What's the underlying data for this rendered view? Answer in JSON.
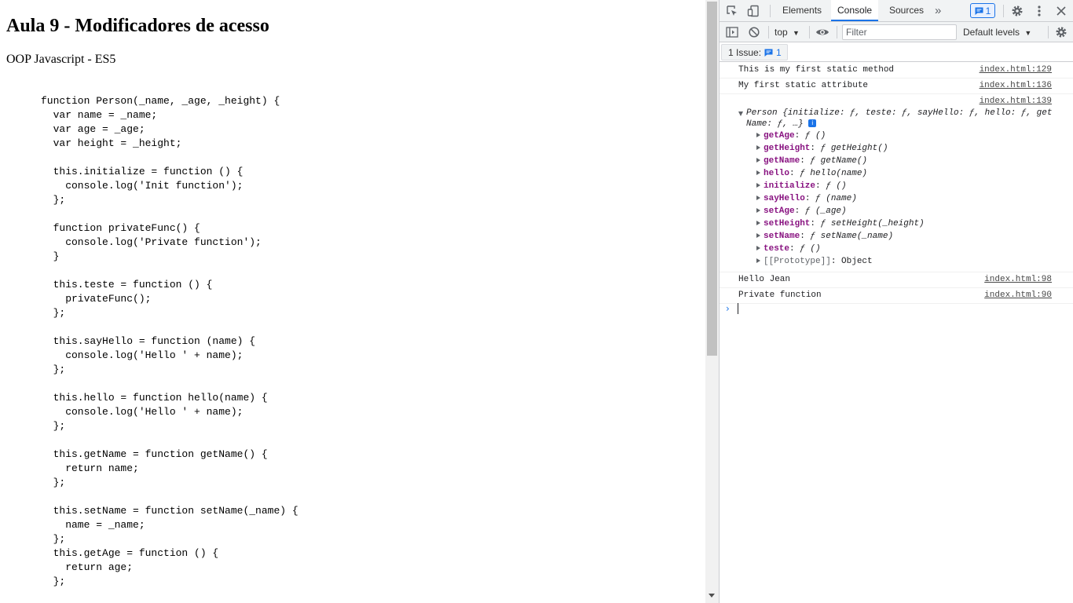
{
  "page": {
    "title": "Aula 9 - Modificadores de acesso",
    "subtitle": "OOP Javascript - ES5",
    "code_lines": [
      "function Person(_name, _age, _height) {",
      "  var name = _name;",
      "  var age = _age;",
      "  var height = _height;",
      "",
      "  this.initialize = function () {",
      "    console.log('Init function');",
      "  };",
      "",
      "  function privateFunc() {",
      "    console.log('Private function');",
      "  }",
      "",
      "  this.teste = function () {",
      "    privateFunc();",
      "  };",
      "",
      "  this.sayHello = function (name) {",
      "    console.log('Hello ' + name);",
      "  };",
      "",
      "  this.hello = function hello(name) {",
      "    console.log('Hello ' + name);",
      "  };",
      "",
      "  this.getName = function getName() {",
      "    return name;",
      "  };",
      "",
      "  this.setName = function setName(_name) {",
      "    name = _name;",
      "  };",
      "  this.getAge = function () {",
      "    return age;",
      "  };"
    ]
  },
  "devtools": {
    "tabs": [
      "Elements",
      "Console",
      "Sources"
    ],
    "active_tab": "Console",
    "more_tabs_glyph": "»",
    "issues_badge_count": "1",
    "toolbar": {
      "context": "top",
      "filter_placeholder": "Filter",
      "levels": "Default levels"
    },
    "issues_bar": {
      "label": "1 Issue:",
      "count": "1"
    },
    "messages": [
      {
        "text": "This is my first static method",
        "source": "index.html:129"
      },
      {
        "text": "My first static attribute",
        "source": "index.html:136"
      }
    ],
    "object_message": {
      "source": "index.html:139",
      "summary": "Person {initialize: ƒ, teste: ƒ, sayHello: ƒ, hello: ƒ, getName: ƒ, …}",
      "info_glyph": "i",
      "properties": [
        {
          "key": "getAge",
          "value": "ƒ ()"
        },
        {
          "key": "getHeight",
          "value": "ƒ getHeight()"
        },
        {
          "key": "getName",
          "value": "ƒ getName()"
        },
        {
          "key": "hello",
          "value": "ƒ hello(name)"
        },
        {
          "key": "initialize",
          "value": "ƒ ()"
        },
        {
          "key": "sayHello",
          "value": "ƒ (name)"
        },
        {
          "key": "setAge",
          "value": "ƒ (_age)"
        },
        {
          "key": "setHeight",
          "value": "ƒ setHeight(_height)"
        },
        {
          "key": "setName",
          "value": "ƒ setName(_name)"
        },
        {
          "key": "teste",
          "value": "ƒ ()"
        }
      ],
      "prototype": {
        "key": "[[Prototype]]",
        "value": "Object"
      }
    },
    "messages_after": [
      {
        "text": "Hello Jean",
        "source": "index.html:98"
      },
      {
        "text": "Private function",
        "source": "index.html:90"
      }
    ],
    "prompt_glyph": "›"
  },
  "colors": {
    "accent": "#1a73e8",
    "property_key": "#881280",
    "toolbar_bg": "#f1f3f4"
  },
  "icons": [
    "inspect-element-icon",
    "device-toolbar-icon",
    "settings-gear-icon",
    "more-vertical-icon",
    "close-icon",
    "sidebar-toggle-icon",
    "clear-console-icon",
    "live-expression-eye-icon",
    "console-settings-gear-icon",
    "issues-message-icon"
  ]
}
